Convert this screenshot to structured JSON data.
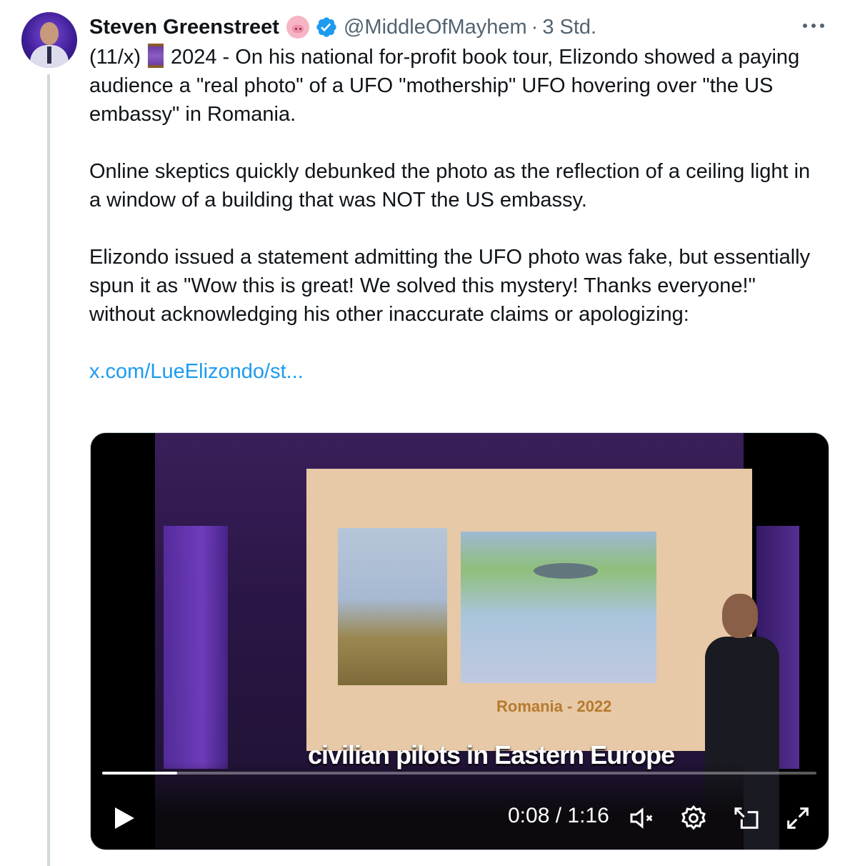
{
  "author": {
    "name": "Steven Greenstreet",
    "handle": "@MiddleOfMayhem",
    "separator": "·",
    "time": "3 Std."
  },
  "tweet": {
    "para1_prefix": "(11/x)",
    "para1_rest": "2024 - On his national for-profit book tour, Elizondo showed a paying audience a \"real photo\" of a UFO \"mothership\" UFO hovering over \"the US embassy\" in Romania.",
    "para2": "Online skeptics quickly debunked the photo as the reflection of a ceiling light in a window of a building that was NOT the US embassy.",
    "para3": "Elizondo issued a statement admitting the UFO photo was fake, but essentially spun it as \"Wow this is great! We solved this mystery! Thanks everyone!\" without acknowledging his other inaccurate claims or apologizing:",
    "link": "x.com/LueElizondo/st..."
  },
  "video": {
    "slide_caption": "Romania - 2022",
    "subtitle": "civilian pilots in Eastern Europe",
    "timecode": "0:08 / 1:16",
    "progress": 0.105
  },
  "icons": {
    "more": "more-horizontal-icon",
    "verified": "verified-badge-icon",
    "pig": "pig-face-emoji",
    "thread": "thread-spool-emoji",
    "play": "play-icon",
    "mute": "volume-muted-icon",
    "settings": "gear-icon",
    "dock": "picture-in-picture-icon",
    "fullscreen": "expand-icon"
  },
  "colors": {
    "link": "#1d9bf0",
    "muted_text": "#536471",
    "verified": "#1d9bf0"
  }
}
